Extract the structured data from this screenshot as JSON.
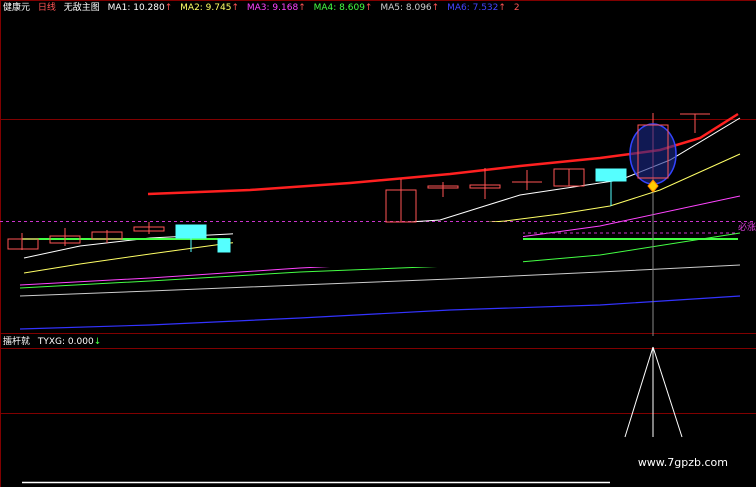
{
  "header": {
    "stock": "健康元",
    "period": "日线",
    "formula": "无敌主图",
    "ma": [
      {
        "label": "MA1: 10.280",
        "color": "#ffffff",
        "arrow": "↑"
      },
      {
        "label": "MA2: 9.745",
        "color": "#ffff66",
        "arrow": "↑"
      },
      {
        "label": "MA3: 9.168",
        "color": "#ff44ff",
        "arrow": "↑"
      },
      {
        "label": "MA4: 8.609",
        "color": "#44ff44",
        "arrow": "↑"
      },
      {
        "label": "MA5: 8.096",
        "color": "#cccccc",
        "arrow": "↑"
      },
      {
        "label": "MA6: 7.532",
        "color": "#4444ff",
        "arrow": "↑"
      }
    ],
    "end_marker": "2"
  },
  "side_label": "必涨",
  "sub": {
    "name": "擂杆就",
    "value": "TYXG: 0.000",
    "arrow": "↓"
  },
  "watermark": "www.7gpzb.com",
  "colors": {
    "up_candle": "#ff5555",
    "down_candle": "#55ffff",
    "ma1": "#ffffff",
    "ma2": "#ffff66",
    "ma3": "#ff44ff",
    "ma4": "#44ff44",
    "ma5": "#cccccc",
    "ma6": "#3333ff",
    "trend": "#ff2020",
    "grid": "#800000"
  }
}
